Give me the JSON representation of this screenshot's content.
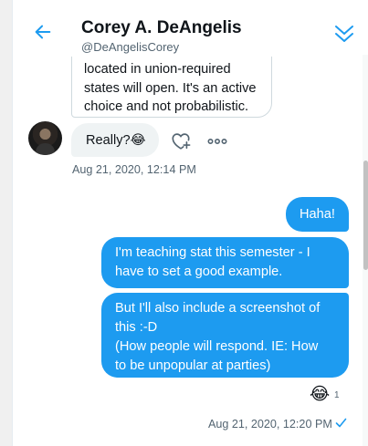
{
  "header": {
    "name": "Corey A. DeAngelis",
    "handle": "@DeAngelisCorey"
  },
  "colors": {
    "accent": "#1d9bf0",
    "incoming_bubble": "#eff3f4",
    "muted_text": "#536471"
  },
  "icons": {
    "back": "arrow-left-icon",
    "collapse": "double-chevron-down-icon",
    "react": "heart-plus-icon",
    "more": "more-horizontal-icon",
    "seen": "checkmark-icon"
  },
  "messages": {
    "incoming_partial": {
      "lines": [
        "located in union-required",
        "states will open. It's an active",
        "choice and not probabilistic."
      ]
    },
    "incoming_really": {
      "text": "Really?😂",
      "timestamp": "Aug 21, 2020, 12:14 PM"
    },
    "outgoing": [
      {
        "lines": [
          "Haha!"
        ]
      },
      {
        "lines": [
          "I'm teaching stat this semester - I",
          "have to set a good example."
        ]
      },
      {
        "lines": [
          "But I'll also include a screenshot of",
          "this :-D",
          "(How people will respond. IE: How",
          "to be unpopular at parties)"
        ]
      }
    ],
    "reaction": {
      "emoji": "😂",
      "count": "1"
    },
    "outgoing_timestamp": "Aug 21, 2020, 12:20 PM"
  }
}
